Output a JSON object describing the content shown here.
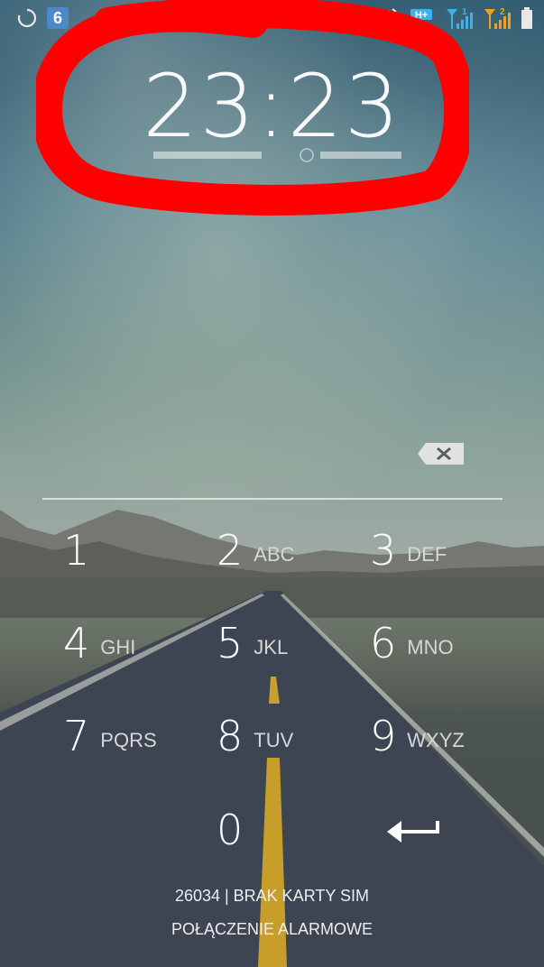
{
  "status_bar": {
    "notification_badge": "6",
    "left_icons": [
      "sync-icon",
      "app-badge-icon"
    ],
    "right_icons": [
      "alarm-icon",
      "hsdpa-icon",
      "signal-sim1-icon",
      "signal-sim2-icon",
      "battery-icon"
    ],
    "network_labels": [
      "H+",
      "1",
      "2"
    ]
  },
  "clock": {
    "time": "23:23"
  },
  "keypad": {
    "keys": [
      {
        "digit": "1",
        "letters": ""
      },
      {
        "digit": "2",
        "letters": "ABC"
      },
      {
        "digit": "3",
        "letters": "DEF"
      },
      {
        "digit": "4",
        "letters": "GHI"
      },
      {
        "digit": "5",
        "letters": "JKL"
      },
      {
        "digit": "6",
        "letters": "MNO"
      },
      {
        "digit": "7",
        "letters": "PQRS"
      },
      {
        "digit": "8",
        "letters": "TUV"
      },
      {
        "digit": "9",
        "letters": "WXYZ"
      },
      {
        "digit": "0",
        "letters": ""
      }
    ],
    "backspace_icon": "backspace-icon",
    "enter_icon": "enter-arrow-icon"
  },
  "footer": {
    "carrier_status": "26034 | BRAK KARTY SIM",
    "emergency_call": "POŁĄCZENIE ALARMOWE"
  },
  "colors": {
    "annotation_red": "#ff0000",
    "status_blue": "#3fb0e8",
    "status_orange": "#f0a020",
    "badge_blue": "#4d88c9"
  }
}
